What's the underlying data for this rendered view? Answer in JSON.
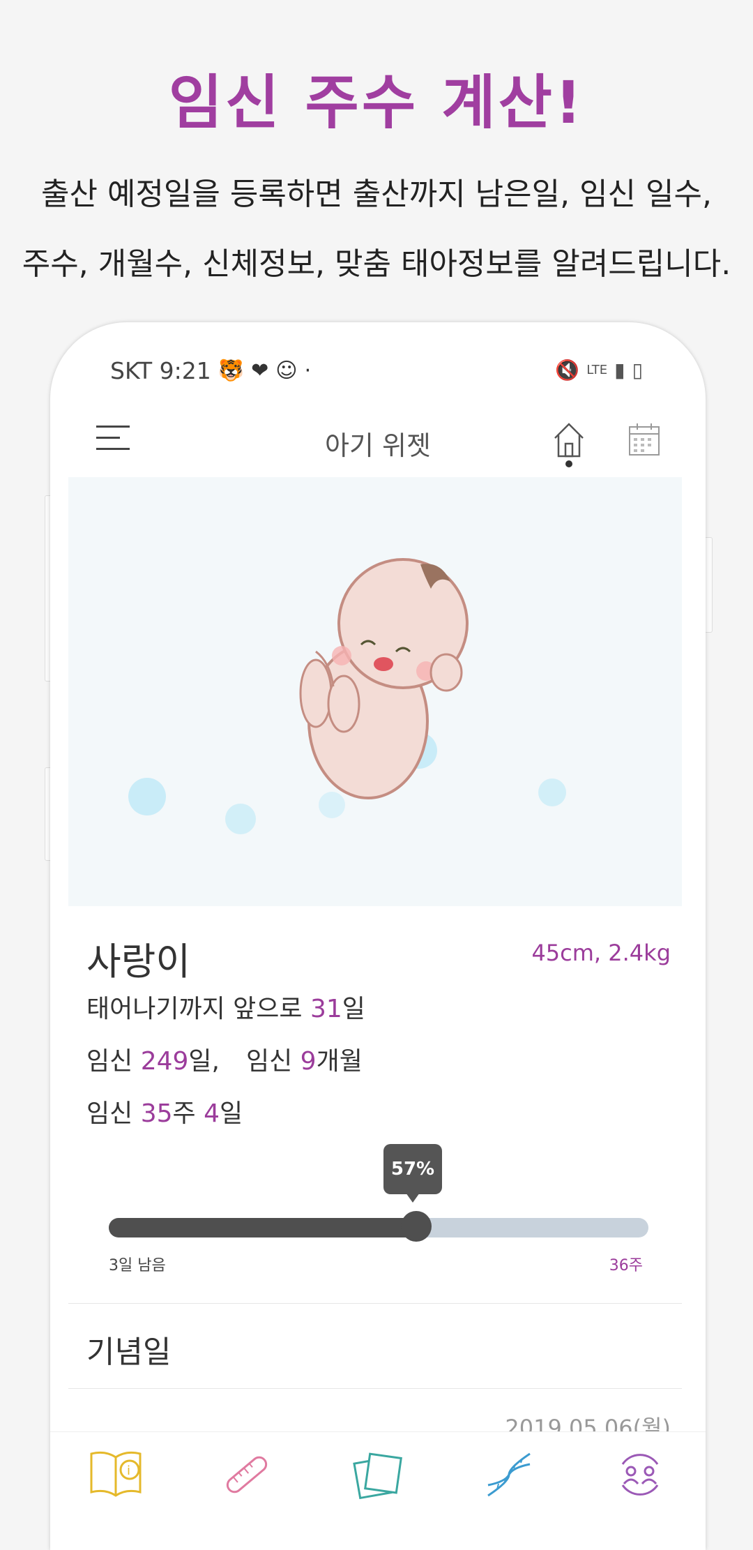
{
  "promo": {
    "headline": "임신 주수 계산!",
    "line1": "출산 예정일을 등록하면 출산까지 남은일, 임신 일수,",
    "line2": "주수, 개월수, 신체정보, 맞춤 태아정보를 알려드립니다."
  },
  "status_bar": {
    "carrier_time": "SKT 9:21",
    "signal": "LTE"
  },
  "app_bar": {
    "title": "아기 위젯"
  },
  "baby": {
    "name": "사랑이",
    "size": "45cm, 2.4kg",
    "days_left_prefix": "태어나기까지 앞으로 ",
    "days_left": "31",
    "days_left_suffix": "일",
    "preg_prefix": "임신 ",
    "preg_days": "249",
    "preg_days_suffix": "일,",
    "preg_month_prefix": "임신 ",
    "preg_month": "9",
    "preg_month_suffix": "개월",
    "week_prefix": "임신 ",
    "weeks": "35",
    "week_suffix": "주 ",
    "week_days": "4",
    "week_days_suffix": "일"
  },
  "progress": {
    "percent_label": "57%",
    "value": 0.57,
    "left_label": "3일 남음",
    "right_label": "36주"
  },
  "anniversary": {
    "title": "기념일",
    "date": "2019.05.06(월)"
  },
  "colors": {
    "accent": "#9b3c9b",
    "bubble": "#c9ecf8",
    "nav_book": "#e5b92b",
    "nav_ruler": "#e07aa0",
    "nav_note": "#3aa7a0",
    "nav_dna": "#3b9bd0",
    "nav_people": "#9b59b6"
  },
  "icons": [
    "menu-icon",
    "home-icon",
    "calendar-icon",
    "book-info-icon",
    "ruler-icon",
    "notes-icon",
    "dna-icon",
    "people-sync-icon"
  ]
}
